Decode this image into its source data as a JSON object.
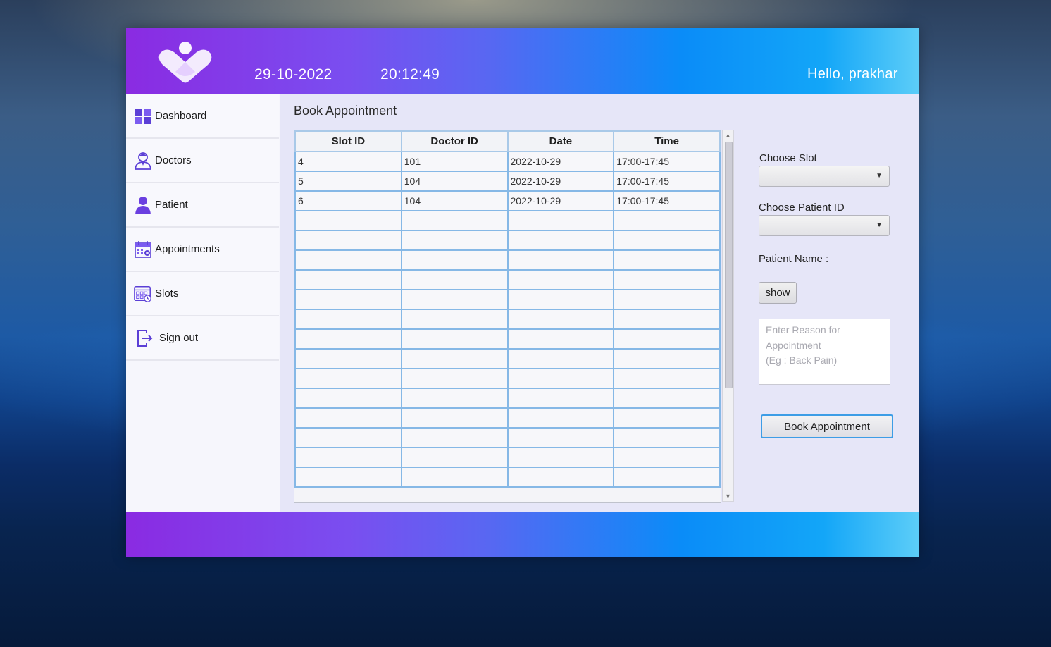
{
  "header": {
    "date": "29-10-2022",
    "time": "20:12:49",
    "greeting": "Hello, prakhar",
    "logo_icon": "heart-logo-icon",
    "gradient_colors": [
      "#8a2be2",
      "#0a8cf8",
      "#5ccdf8"
    ]
  },
  "sidebar": {
    "items": [
      {
        "label": "Dashboard",
        "icon": "dashboard-grid-icon"
      },
      {
        "label": "Doctors",
        "icon": "doctor-icon"
      },
      {
        "label": "Patient",
        "icon": "person-icon"
      },
      {
        "label": "Appointments",
        "icon": "calendar-icon"
      },
      {
        "label": "Slots",
        "icon": "slots-calendar-icon"
      },
      {
        "label": "Sign out",
        "icon": "sign-out-icon"
      }
    ]
  },
  "main": {
    "title": "Book Appointment",
    "table": {
      "columns": [
        "Slot ID",
        "Doctor ID",
        "Date",
        "Time"
      ],
      "rows": [
        [
          "4",
          "101",
          "2022-10-29",
          "17:00-17:45"
        ],
        [
          "5",
          "104",
          "2022-10-29",
          "17:00-17:45"
        ],
        [
          "6",
          "104",
          "2022-10-29",
          "17:00-17:45"
        ],
        [
          "",
          "",
          "",
          ""
        ],
        [
          "",
          "",
          "",
          ""
        ],
        [
          "",
          "",
          "",
          ""
        ],
        [
          "",
          "",
          "",
          ""
        ],
        [
          "",
          "",
          "",
          ""
        ],
        [
          "",
          "",
          "",
          ""
        ],
        [
          "",
          "",
          "",
          ""
        ],
        [
          "",
          "",
          "",
          ""
        ],
        [
          "",
          "",
          "",
          ""
        ],
        [
          "",
          "",
          "",
          ""
        ],
        [
          "",
          "",
          "",
          ""
        ],
        [
          "",
          "",
          "",
          ""
        ],
        [
          "",
          "",
          "",
          ""
        ],
        [
          "",
          "",
          "",
          ""
        ]
      ]
    },
    "form": {
      "choose_slot_label": "Choose Slot",
      "choose_slot_value": "",
      "choose_patient_label": "Choose Patient ID",
      "choose_patient_value": "",
      "patient_name_label": "Patient Name :",
      "show_button": "show",
      "reason_placeholder": "Enter Reason for\nAppointment\n(Eg : Back Pain)",
      "book_button": "Book Appointment"
    }
  }
}
